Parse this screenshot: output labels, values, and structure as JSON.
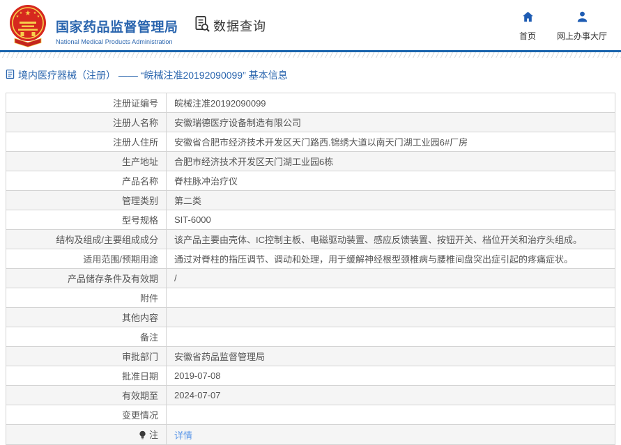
{
  "colors": {
    "accent_blue": "#2a65ae",
    "rule_blue": "#1a64ad",
    "icon_blue": "#1e5cb3",
    "link_blue": "#5a96e8",
    "emblem_red": "#d6281e",
    "emblem_gold": "#f7d04b",
    "row_alt_bg": "#f5f5f5",
    "table_border": "#d4d4d4",
    "body_text": "#555555"
  },
  "header": {
    "title": "国家药品监督管理局",
    "subtitle": "National Medical Products Administration",
    "query_label": "数据查询",
    "nav": [
      {
        "label": "首页",
        "icon": "home-icon"
      },
      {
        "label": "网上办事大厅",
        "icon": "user-icon"
      }
    ]
  },
  "breadcrumb": {
    "text": "境内医疗器械（注册） —— “皖械注准20192090099” 基本信息"
  },
  "table": {
    "rows": [
      {
        "label": "注册证编号",
        "value": "皖械注准20192090099"
      },
      {
        "label": "注册人名称",
        "value": "安徽瑞德医疗设备制造有限公司"
      },
      {
        "label": "注册人住所",
        "value": "安徽省合肥市经济技术开发区天门路西.锦绣大道以南天门湖工业园6#厂房"
      },
      {
        "label": "生产地址",
        "value": "合肥市经济技术开发区天门湖工业园6栋"
      },
      {
        "label": "产品名称",
        "value": "脊柱脉冲治疗仪"
      },
      {
        "label": "管理类别",
        "value": "第二类"
      },
      {
        "label": "型号规格",
        "value": "SIT-6000"
      },
      {
        "label": "结构及组成/主要组成成分",
        "value": "该产品主要由壳体、IC控制主板、电磁驱动装置、感应反馈装置、按钮开关、档位开关和治疗头组成。"
      },
      {
        "label": "适用范围/预期用途",
        "value": "通过对脊柱的指压调节、调动和处理，用于缓解神经根型颈椎病与腰椎间盘突出症引起的疼痛症状。"
      },
      {
        "label": "产品储存条件及有效期",
        "value": "/"
      },
      {
        "label": "附件",
        "value": ""
      },
      {
        "label": "其他内容",
        "value": ""
      },
      {
        "label": "备注",
        "value": ""
      },
      {
        "label": "审批部门",
        "value": "安徽省药品监督管理局"
      },
      {
        "label": "批准日期",
        "value": "2019-07-08"
      },
      {
        "label": "有效期至",
        "value": "2024-07-07"
      },
      {
        "label": "变更情况",
        "value": ""
      },
      {
        "label": "注",
        "value": "详情",
        "label_icon": "bulb-icon",
        "value_type": "link"
      }
    ]
  }
}
